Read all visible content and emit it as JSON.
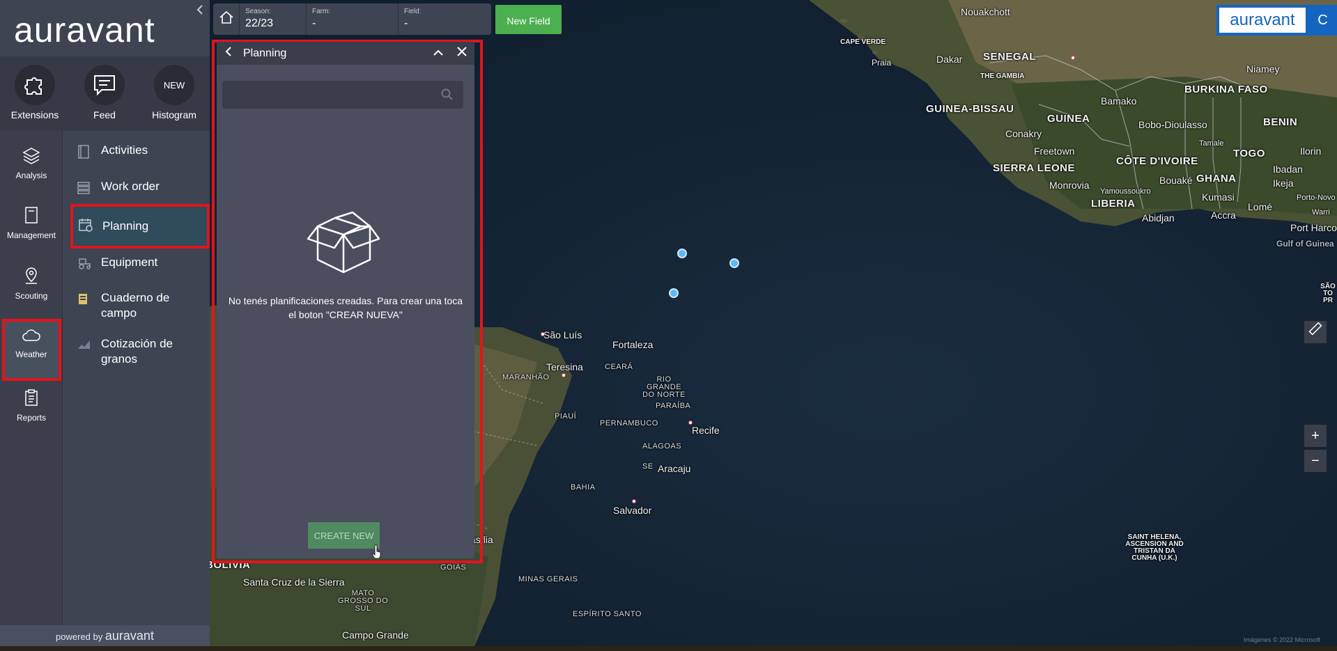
{
  "brand": {
    "logo_text": "auravant",
    "powered_prefix": "powered by",
    "powered_brand": "auravant",
    "badge_word": "auravant",
    "badge_letter": "C"
  },
  "quick_actions": [
    {
      "label": "Extensions",
      "icon": "puzzle-icon"
    },
    {
      "label": "Feed",
      "icon": "chat-icon"
    },
    {
      "label": "Histogram",
      "badge": "NEW"
    }
  ],
  "rail": [
    {
      "label": "Analysis",
      "icon": "layers-icon"
    },
    {
      "label": "Management",
      "icon": "notebook-icon",
      "active": true
    },
    {
      "label": "Scouting",
      "icon": "map-pin-icon"
    },
    {
      "label": "Weather",
      "icon": "cloud-icon"
    },
    {
      "label": "Reports",
      "icon": "clipboard-icon"
    }
  ],
  "submenu": [
    {
      "label": "Activities",
      "icon": "notebook-icon"
    },
    {
      "label": "Work order",
      "icon": "list-icon"
    },
    {
      "label": "Planning",
      "icon": "calendar-icon",
      "active": true
    },
    {
      "label": "Equipment",
      "icon": "tractor-icon"
    },
    {
      "label": "Cuaderno de campo",
      "icon": "field-notebook-icon"
    },
    {
      "label": "Cotización de granos",
      "icon": "chart-icon"
    }
  ],
  "topbar": {
    "season_label": "Season:",
    "season_value": "22/23",
    "farm_label": "Farm:",
    "farm_value": "-",
    "field_label": "Field:",
    "field_value": "-",
    "new_field": "New Field"
  },
  "panel": {
    "title": "Planning",
    "search_placeholder": "",
    "empty_message": "No tenés planificaciones creadas. Para crear una toca el boton \"CREAR NUEVA\"",
    "create_button": "CREATE NEW"
  },
  "map": {
    "labels": [
      {
        "t": "Nouakchott"
      },
      {
        "t": "CAPE VERDE"
      },
      {
        "t": "Praia"
      },
      {
        "t": "Dakar"
      },
      {
        "t": "SENEGAL"
      },
      {
        "t": "THE GAMBIA"
      },
      {
        "t": "GUINEA-BISSAU"
      },
      {
        "t": "GUINEA"
      },
      {
        "t": "Conakry"
      },
      {
        "t": "Freetown"
      },
      {
        "t": "SIERRA LEONE"
      },
      {
        "t": "Monrovia"
      },
      {
        "t": "LIBERIA"
      },
      {
        "t": "Bamako"
      },
      {
        "t": "BURKINA FASO"
      },
      {
        "t": "Niamey"
      },
      {
        "t": "Bobo-Dioulasso"
      },
      {
        "t": "BENIN"
      },
      {
        "t": "Tamale"
      },
      {
        "t": "TOGO"
      },
      {
        "t": "CÔTE D'IVOIRE"
      },
      {
        "t": "Bouaké"
      },
      {
        "t": "GHANA"
      },
      {
        "t": "Yamoussoukro"
      },
      {
        "t": "Kumasi"
      },
      {
        "t": "Abidjan"
      },
      {
        "t": "Accra"
      },
      {
        "t": "Lomé"
      },
      {
        "t": "Ibadan"
      },
      {
        "t": "Ikeja"
      },
      {
        "t": "Ilorin"
      },
      {
        "t": "Porto-Novo"
      },
      {
        "t": "Warri"
      },
      {
        "t": "Port Harco"
      },
      {
        "t": "Gulf of Guinea"
      },
      {
        "t": "São Luís"
      },
      {
        "t": "Fortaleza"
      },
      {
        "t": "Teresina"
      },
      {
        "t": "MARANHÃO"
      },
      {
        "t": "CEARÁ"
      },
      {
        "t": "RIO GRANDE DO NORTE"
      },
      {
        "t": "PARAÍBA"
      },
      {
        "t": "PIAUÍ"
      },
      {
        "t": "PERNAMBUCO"
      },
      {
        "t": "Recife"
      },
      {
        "t": "ALAGOAS"
      },
      {
        "t": "SE"
      },
      {
        "t": "Aracaju"
      },
      {
        "t": "BAHIA"
      },
      {
        "t": "Salvador"
      },
      {
        "t": "MINAS GERAIS"
      },
      {
        "t": "ESPÍRITO SANTO"
      },
      {
        "t": "GOIÁS"
      },
      {
        "t": "BOLIVIA"
      },
      {
        "t": "Santa Cruz de la Sierra"
      },
      {
        "t": "MATO GROSSO DO SUL"
      },
      {
        "t": "Campo Grande"
      },
      {
        "t": "Brasília"
      },
      {
        "t": "SAINT HELENA, ASCENSION AND TRISTAN DA CUNHA (U.K.)"
      },
      {
        "t": "SÃO TO PR"
      }
    ],
    "attribution": "Imágenes © 2022 Microsoft",
    "zoom_in": "+",
    "zoom_out": "−"
  },
  "colors": {
    "sidebar": "#3f4452",
    "highlight": "#e2141b",
    "new_field": "#4caf50",
    "create_new": "#4f8a61",
    "badge": "#1565c0"
  }
}
